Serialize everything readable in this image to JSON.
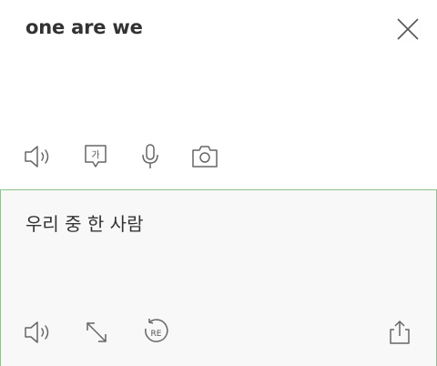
{
  "source": {
    "text": "one are we",
    "icons": {
      "close": "close-icon",
      "speaker": "speaker-icon",
      "handwriting": "handwriting-icon",
      "handwriting_glyph": "가",
      "microphone": "microphone-icon",
      "camera": "camera-icon"
    }
  },
  "target": {
    "text": "우리 중 한 사람",
    "accent_border": "#8bc38b",
    "icons": {
      "speaker": "speaker-icon",
      "expand": "expand-icon",
      "retranslate": "retranslate-icon",
      "retranslate_glyph": "RE",
      "share": "share-icon"
    }
  }
}
